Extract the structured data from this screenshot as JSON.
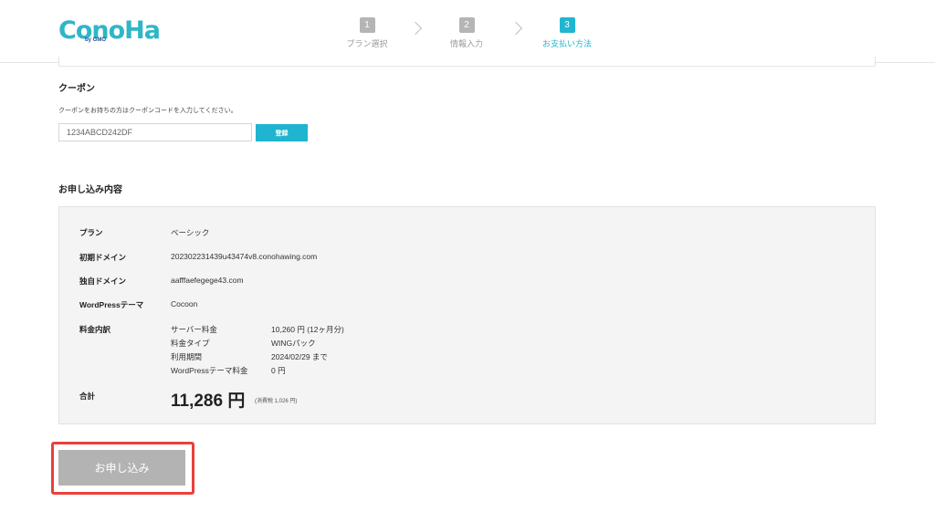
{
  "header": {
    "logo_text": "ConoHa",
    "logo_sub": "by GMO",
    "steps": [
      {
        "num": "1",
        "label": "プラン選択"
      },
      {
        "num": "2",
        "label": "情報入力"
      },
      {
        "num": "3",
        "label": "お支払い方法"
      }
    ],
    "active_step": 3
  },
  "coupon": {
    "title": "クーポン",
    "description": "クーポンをお持ちの方はクーポンコードを入力してください。",
    "input_value": "1234ABCD242DF",
    "register_label": "登録"
  },
  "summary": {
    "title": "お申し込み内容",
    "rows": [
      {
        "label": "プラン",
        "value": "ベーシック"
      },
      {
        "label": "初期ドメイン",
        "value": "202302231439u43474v8.conohawing.com"
      },
      {
        "label": "独自ドメイン",
        "value": "aafffaefegege43.com"
      },
      {
        "label": "WordPressテーマ",
        "value": "Cocoon"
      }
    ],
    "breakdown": {
      "label": "料金内訳",
      "items": [
        {
          "label": "サーバー料金",
          "value": "10,260 円 (12ヶ月分)"
        },
        {
          "label": "料金タイプ",
          "value": "WINGパック"
        },
        {
          "label": "利用期間",
          "value": "2024/02/29 まで"
        },
        {
          "label": "WordPressテーマ料金",
          "value": "0 円"
        }
      ]
    },
    "total": {
      "label": "合計",
      "amount": "11,286 円",
      "tax_note": "(消費税 1,026 円)"
    }
  },
  "apply_button": {
    "label": "お申し込み"
  },
  "colors": {
    "accent": "#1fb4cf",
    "highlight": "#e8403c",
    "button_disabled": "#b3b3b3"
  }
}
